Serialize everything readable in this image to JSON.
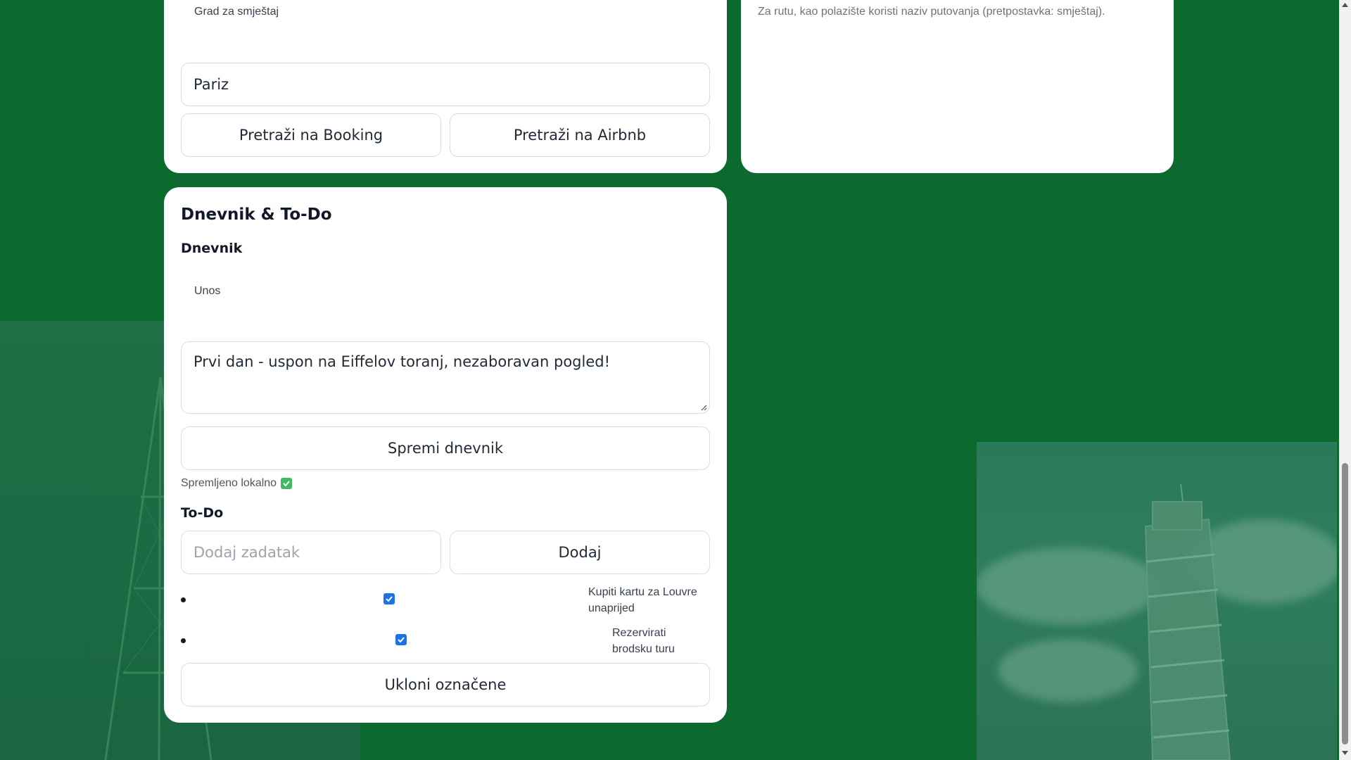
{
  "lodging": {
    "city_label": "Grad za smještaj",
    "city_value": "Pariz",
    "booking_button": "Pretraži na Booking",
    "airbnb_button": "Pretraži na Airbnb"
  },
  "route": {
    "hint": "Za rutu, kao polazište koristi naziv putovanja (pretpostavka: smještaj)."
  },
  "diary_card": {
    "title": "Dnevnik & To-Do",
    "diary_heading": "Dnevnik",
    "entry_label": "Unos",
    "entry_value": "Prvi dan - uspon na Eiffelov toranj, nezaboravan pogled!",
    "save_button": "Spremi dnevnik",
    "saved_status": "Spremljeno lokalno",
    "todo_heading": "To-Do",
    "todo_placeholder": "Dodaj zadatak",
    "add_button": "Dodaj",
    "todo_items": [
      {
        "line1": "Kupiti kartu za Louvre",
        "line2": "unaprijed",
        "checked": true
      },
      {
        "line1": "Rezervirati",
        "line2": "brodsku turu",
        "checked": true
      }
    ],
    "remove_checked_button": "Ukloni označene"
  },
  "icons": {
    "saved_check": "check-square-icon",
    "todo_checkbox": "checkbox-checked-icon",
    "scroll_up": "scroll-up-arrow-icon",
    "scroll_down": "scroll-down-arrow-icon"
  },
  "colors": {
    "background": "#0d6a2f",
    "card": "#ffffff",
    "checkbox": "#1a73e8",
    "saved_badge": "#3fba62"
  }
}
